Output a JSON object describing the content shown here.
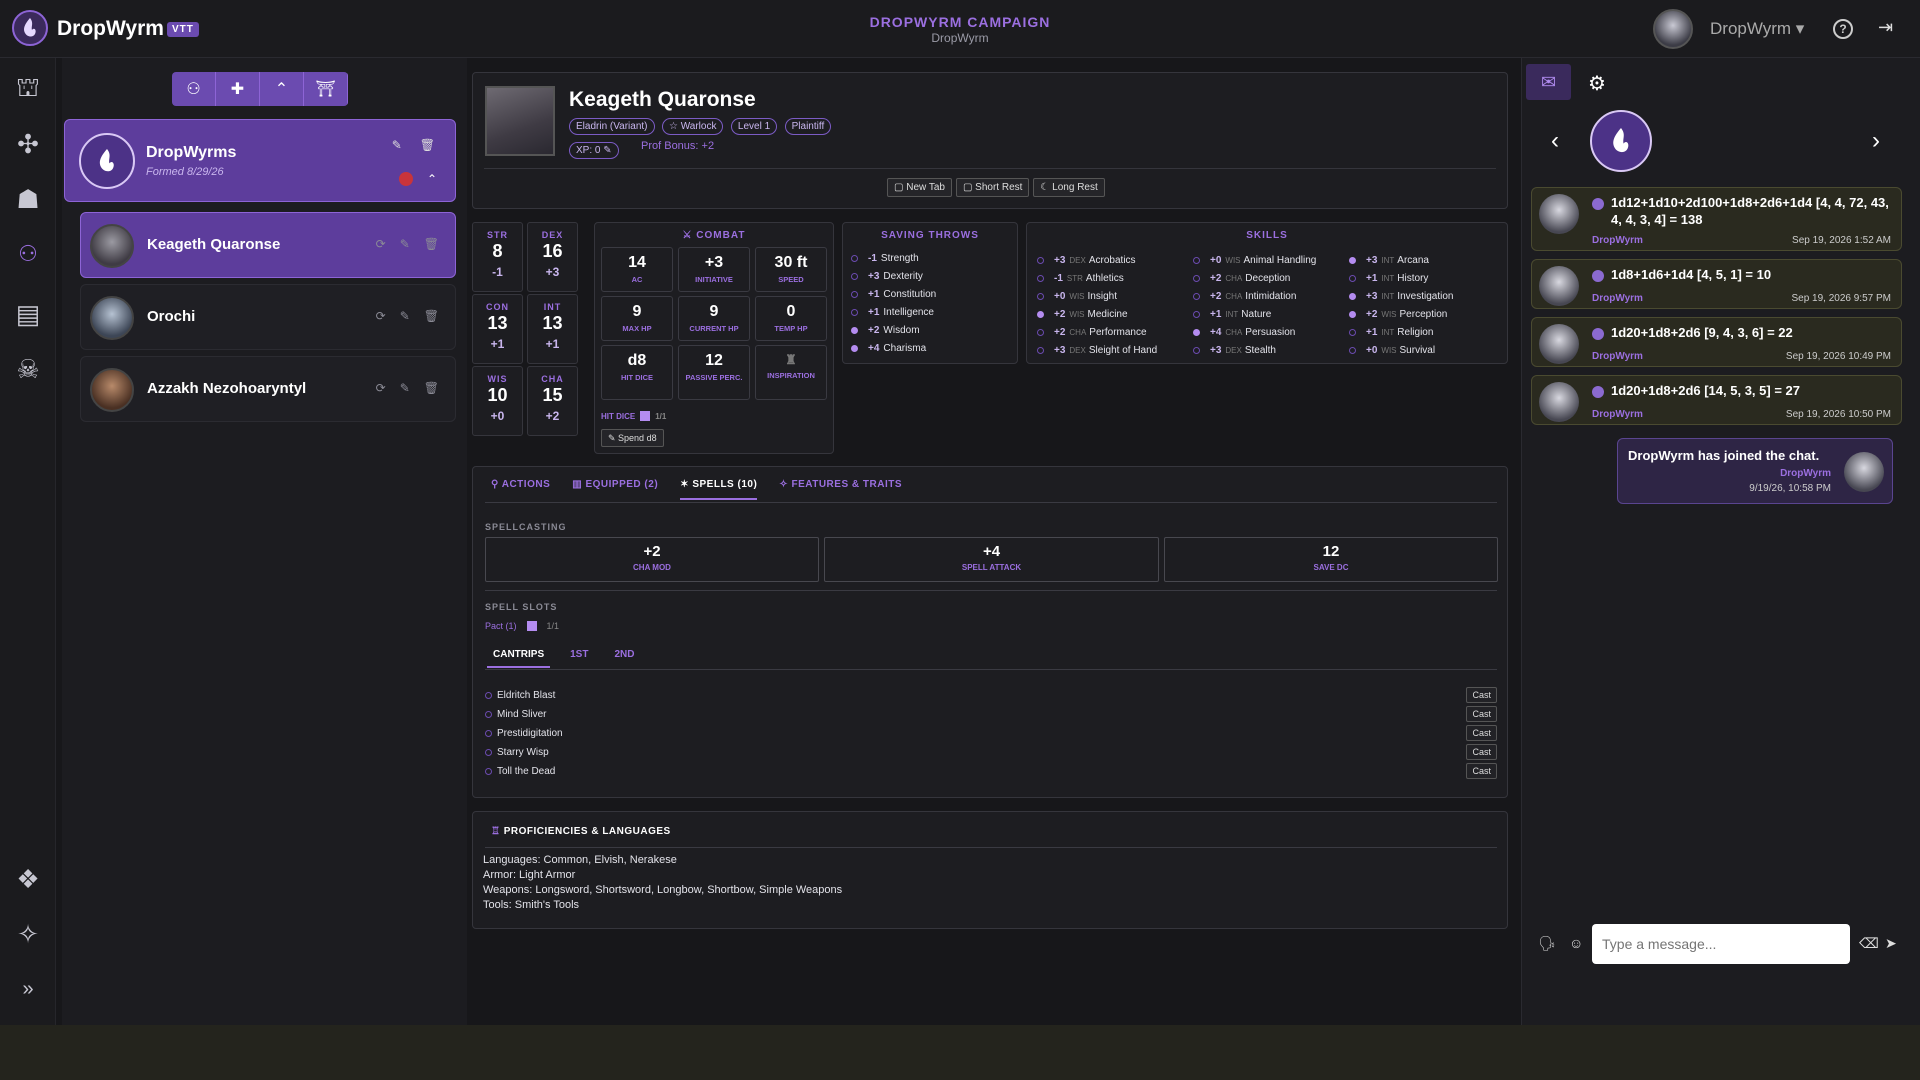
{
  "app": {
    "brand": "DropWyrm",
    "badge": "VTT"
  },
  "campaign": {
    "title": "DROPWYRM CAMPAIGN",
    "subtitle": "DropWyrm"
  },
  "user": {
    "name": "DropWyrm ▾"
  },
  "party": {
    "name": "DropWyrms",
    "formed": "Formed 8/29/26"
  },
  "characters": [
    {
      "name": "Keageth Quaronse"
    },
    {
      "name": "Orochi"
    },
    {
      "name": "Azzakh Nezohoaryntyl"
    }
  ],
  "sheet": {
    "name": "Keageth Quaronse",
    "tags": [
      "Eladrin (Variant)",
      "☆ Warlock",
      "Level 1",
      "Plaintiff"
    ],
    "xp": "XP: 0 ✎",
    "prof": "Prof Bonus: +2",
    "rest_buttons": [
      "▢ New Tab",
      "▢ Short Rest",
      "☾ Long Rest"
    ],
    "abilities": [
      {
        "n": "STR",
        "v": "8",
        "m": "-1"
      },
      {
        "n": "DEX",
        "v": "16",
        "m": "+3"
      },
      {
        "n": "CON",
        "v": "13",
        "m": "+1"
      },
      {
        "n": "INT",
        "v": "13",
        "m": "+1"
      },
      {
        "n": "WIS",
        "v": "10",
        "m": "+0"
      },
      {
        "n": "CHA",
        "v": "15",
        "m": "+2"
      }
    ],
    "combat": {
      "title": "⚔ COMBAT",
      "boxes": [
        {
          "v": "14",
          "l": "AC"
        },
        {
          "v": "+3",
          "l": "INITIATIVE"
        },
        {
          "v": "30 ft",
          "l": "SPEED"
        },
        {
          "v": "9",
          "l": "MAX HP"
        },
        {
          "v": "9",
          "l": "CURRENT HP"
        },
        {
          "v": "0",
          "l": "TEMP HP"
        },
        {
          "v": "d8",
          "l": "HIT DICE"
        },
        {
          "v": "12",
          "l": "PASSIVE PERC."
        },
        {
          "v": "",
          "l": "INSPIRATION"
        }
      ],
      "hit_dice_label": "HIT DICE",
      "hit_dice_count": "1/1",
      "spend": "✎ Spend d8"
    },
    "saves": {
      "title": "SAVING THROWS",
      "items": [
        {
          "mod": "-1",
          "name": "Strength",
          "on": false
        },
        {
          "mod": "+3",
          "name": "Dexterity",
          "on": false
        },
        {
          "mod": "+1",
          "name": "Constitution",
          "on": false
        },
        {
          "mod": "+1",
          "name": "Intelligence",
          "on": false
        },
        {
          "mod": "+2",
          "name": "Wisdom",
          "on": true
        },
        {
          "mod": "+4",
          "name": "Charisma",
          "on": true
        }
      ]
    },
    "skills": {
      "title": "SKILLS",
      "col1": [
        {
          "mod": "+3",
          "ab": "DEX",
          "name": "Acrobatics",
          "on": false
        },
        {
          "mod": "-1",
          "ab": "STR",
          "name": "Athletics",
          "on": false
        },
        {
          "mod": "+0",
          "ab": "WIS",
          "name": "Insight",
          "on": false
        },
        {
          "mod": "+2",
          "ab": "WIS",
          "name": "Medicine",
          "on": true
        },
        {
          "mod": "+2",
          "ab": "CHA",
          "name": "Performance",
          "on": false
        },
        {
          "mod": "+3",
          "ab": "DEX",
          "name": "Sleight of Hand",
          "on": false
        }
      ],
      "col2": [
        {
          "mod": "+0",
          "ab": "WIS",
          "name": "Animal Handling",
          "on": false
        },
        {
          "mod": "+2",
          "ab": "CHA",
          "name": "Deception",
          "on": false
        },
        {
          "mod": "+2",
          "ab": "CHA",
          "name": "Intimidation",
          "on": false
        },
        {
          "mod": "+1",
          "ab": "INT",
          "name": "Nature",
          "on": false
        },
        {
          "mod": "+4",
          "ab": "CHA",
          "name": "Persuasion",
          "on": true
        },
        {
          "mod": "+3",
          "ab": "DEX",
          "name": "Stealth",
          "on": false
        }
      ],
      "col3": [
        {
          "mod": "+3",
          "ab": "INT",
          "name": "Arcana",
          "on": true
        },
        {
          "mod": "+1",
          "ab": "INT",
          "name": "History",
          "on": false
        },
        {
          "mod": "+3",
          "ab": "INT",
          "name": "Investigation",
          "on": true
        },
        {
          "mod": "+2",
          "ab": "WIS",
          "name": "Perception",
          "on": true
        },
        {
          "mod": "+1",
          "ab": "INT",
          "name": "Religion",
          "on": false
        },
        {
          "mod": "+0",
          "ab": "WIS",
          "name": "Survival",
          "on": false
        }
      ]
    },
    "tabs": [
      "ACTIONS",
      "EQUIPPED (2)",
      "SPELLS (10)",
      "FEATURES & TRAITS"
    ],
    "spellcasting": {
      "title": "SPELLCASTING",
      "boxes": [
        {
          "v": "+2",
          "l": "CHA MOD"
        },
        {
          "v": "+4",
          "l": "SPELL ATTACK"
        },
        {
          "v": "12",
          "l": "SAVE DC"
        }
      ],
      "slots_title": "SPELL SLOTS",
      "pact": "Pact (1)",
      "pact_count": "1/1",
      "levels": [
        "CANTRIPS",
        "1ST",
        "2ND"
      ],
      "cast_label": "Cast",
      "spells": [
        "Eldritch Blast",
        "Mind Sliver",
        "Prestidigitation",
        "Starry Wisp",
        "Toll the Dead"
      ]
    },
    "proficiencies": {
      "title": "PROFICIENCIES & LANGUAGES",
      "lines": [
        "Languages: Common, Elvish, Nerakese",
        "Armor: Light Armor",
        "Weapons: Longsword, Shortsword, Longbow, Shortbow, Simple Weapons",
        "Tools: Smith's Tools"
      ]
    }
  },
  "chat": {
    "rolls": [
      {
        "text": "1d12+1d10+2d100+1d8+2d6+1d4 [4, 4, 72, 43, 4, 4, 3, 4] = 138",
        "who": "DropWyrm",
        "time": "Sep 19, 2026 1:52 AM"
      },
      {
        "text": "1d8+1d6+1d4 [4, 5, 1] = 10",
        "who": "DropWyrm",
        "time": "Sep 19, 2026 9:57 PM"
      },
      {
        "text": "1d20+1d8+2d6 [9, 4, 3, 6] = 22",
        "who": "DropWyrm",
        "time": "Sep 19, 2026 10:49 PM"
      },
      {
        "text": "1d20+1d8+2d6 [14, 5, 3, 5] = 27",
        "who": "DropWyrm",
        "time": "Sep 19, 2026 10:50 PM"
      }
    ],
    "join": {
      "text": "DropWyrm has joined the chat.",
      "who": "DropWyrm",
      "time": "9/19/26, 10:58 PM"
    },
    "placeholder": "Type a message..."
  }
}
